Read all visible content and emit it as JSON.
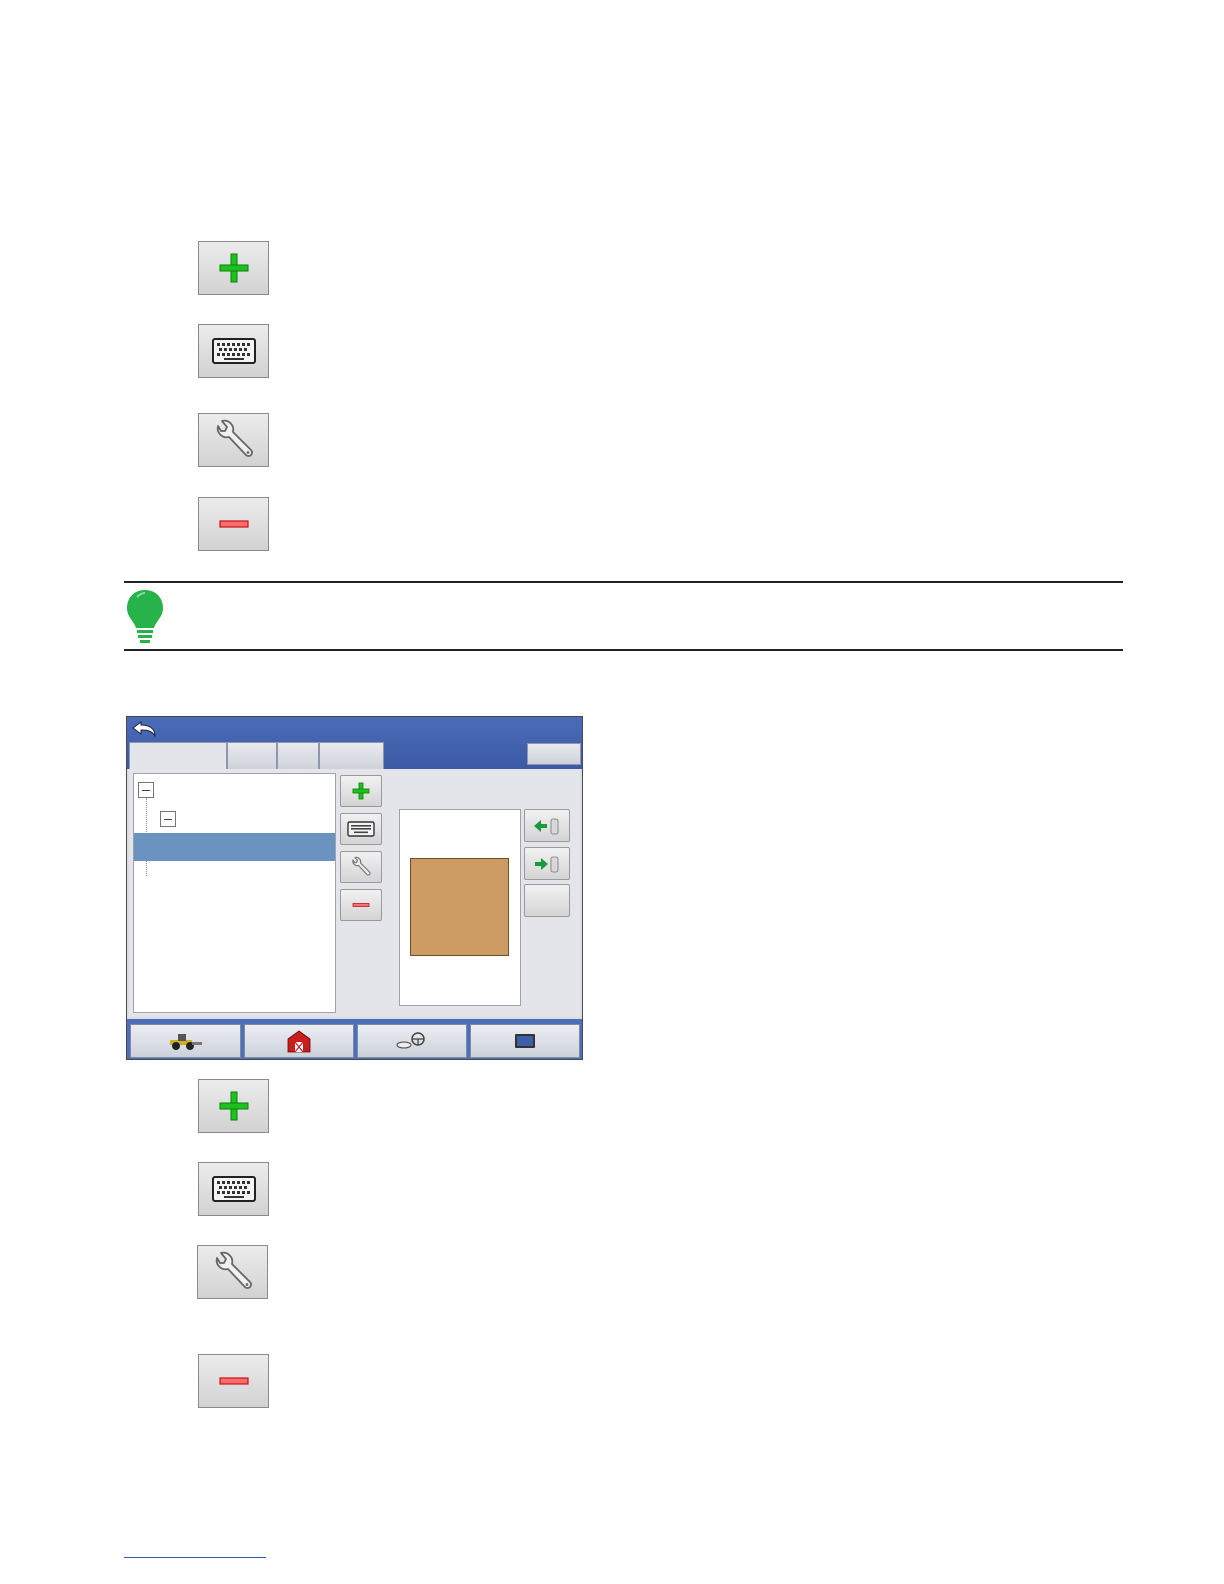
{
  "icons": {
    "add": "plus-icon",
    "rename": "keyboard-icon",
    "edit": "wrench-icon",
    "remove": "minus-icon",
    "note": "lightbulb-icon"
  },
  "colors": {
    "add_green": "#1ec21e",
    "remove_red": "#e0262b",
    "note_green": "#27b34a",
    "titlebar_blue": "#3c5aa6",
    "selection_blue": "#6a93bf",
    "field_tan": "#cc9c64"
  },
  "screen": {
    "back_icon": "back-arrow-icon",
    "tree": {
      "selected_row": 2
    },
    "side_buttons": [
      "plus-icon",
      "keyboard-icon",
      "wrench-icon",
      "minus-icon"
    ],
    "right_buttons": [
      "import-arrow-icon",
      "export-arrow-icon"
    ],
    "footer_icons": [
      "tractor-icon",
      "barn-icon",
      "guidance-icon",
      "display-icon"
    ]
  }
}
